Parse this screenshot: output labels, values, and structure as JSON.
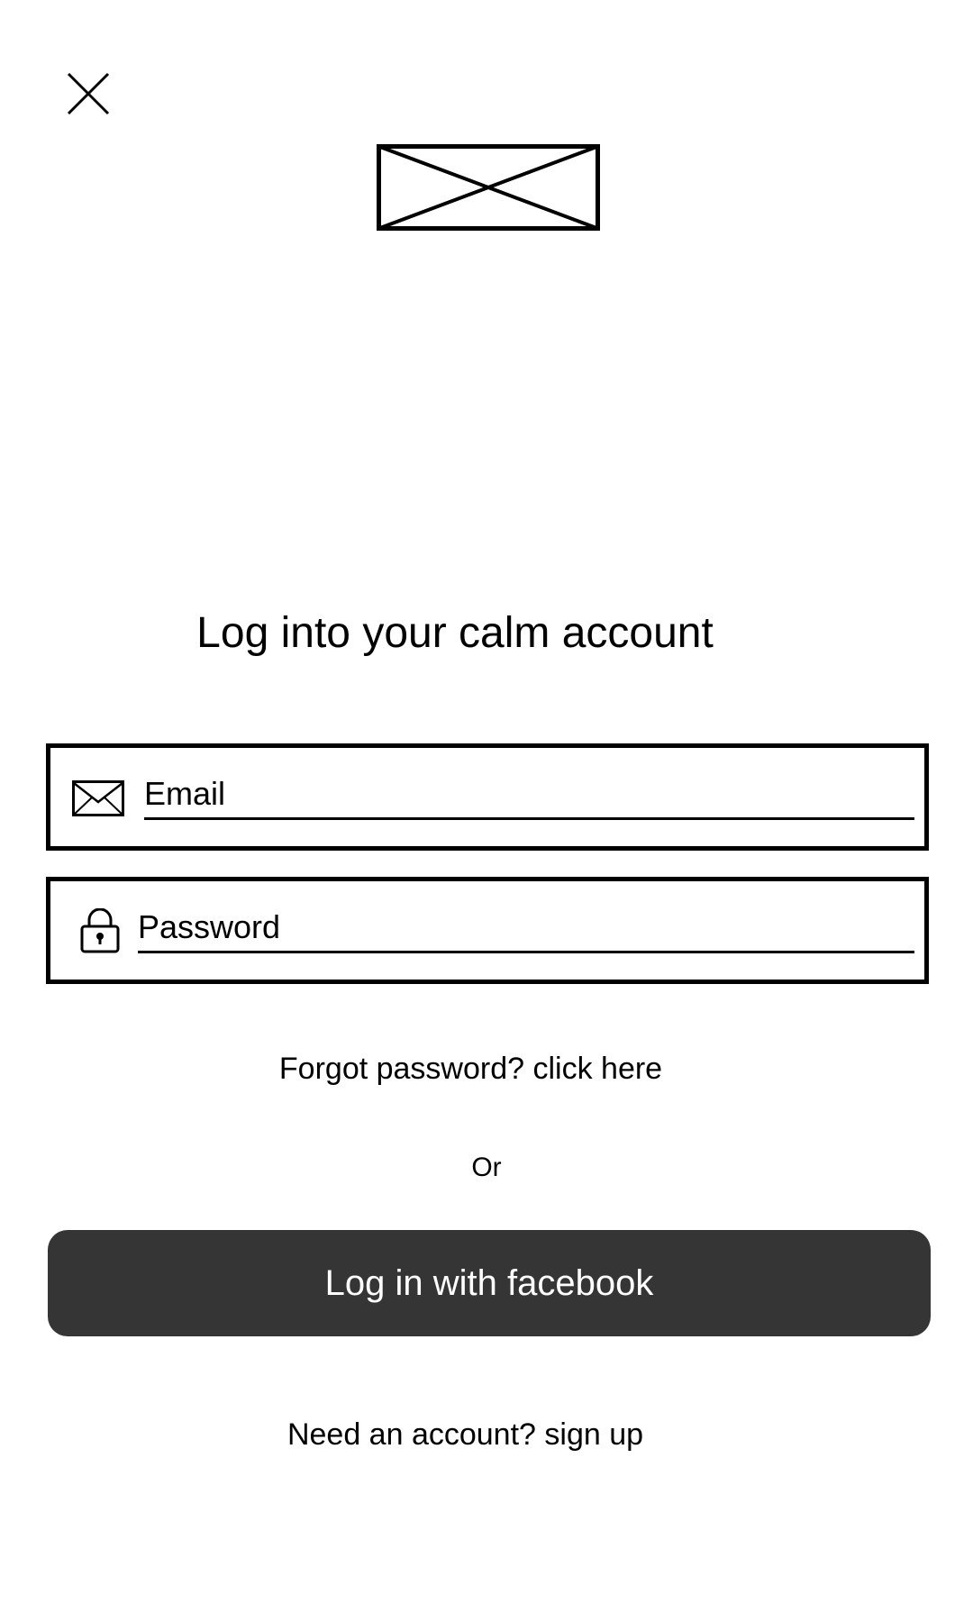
{
  "header": {
    "close_icon": "close-icon",
    "logo_icon": "image-placeholder-icon"
  },
  "title": "Log into your calm account",
  "form": {
    "email": {
      "icon": "envelope-icon",
      "placeholder": "Email",
      "value": ""
    },
    "password": {
      "icon": "lock-icon",
      "placeholder": "Password",
      "value": ""
    }
  },
  "forgot_password_link": "Forgot password? click here",
  "divider_text": "Or",
  "facebook_button": {
    "label": "Log in with facebook",
    "background": "#353535",
    "text_color": "#ffffff"
  },
  "signup_link": "Need an account? sign up"
}
